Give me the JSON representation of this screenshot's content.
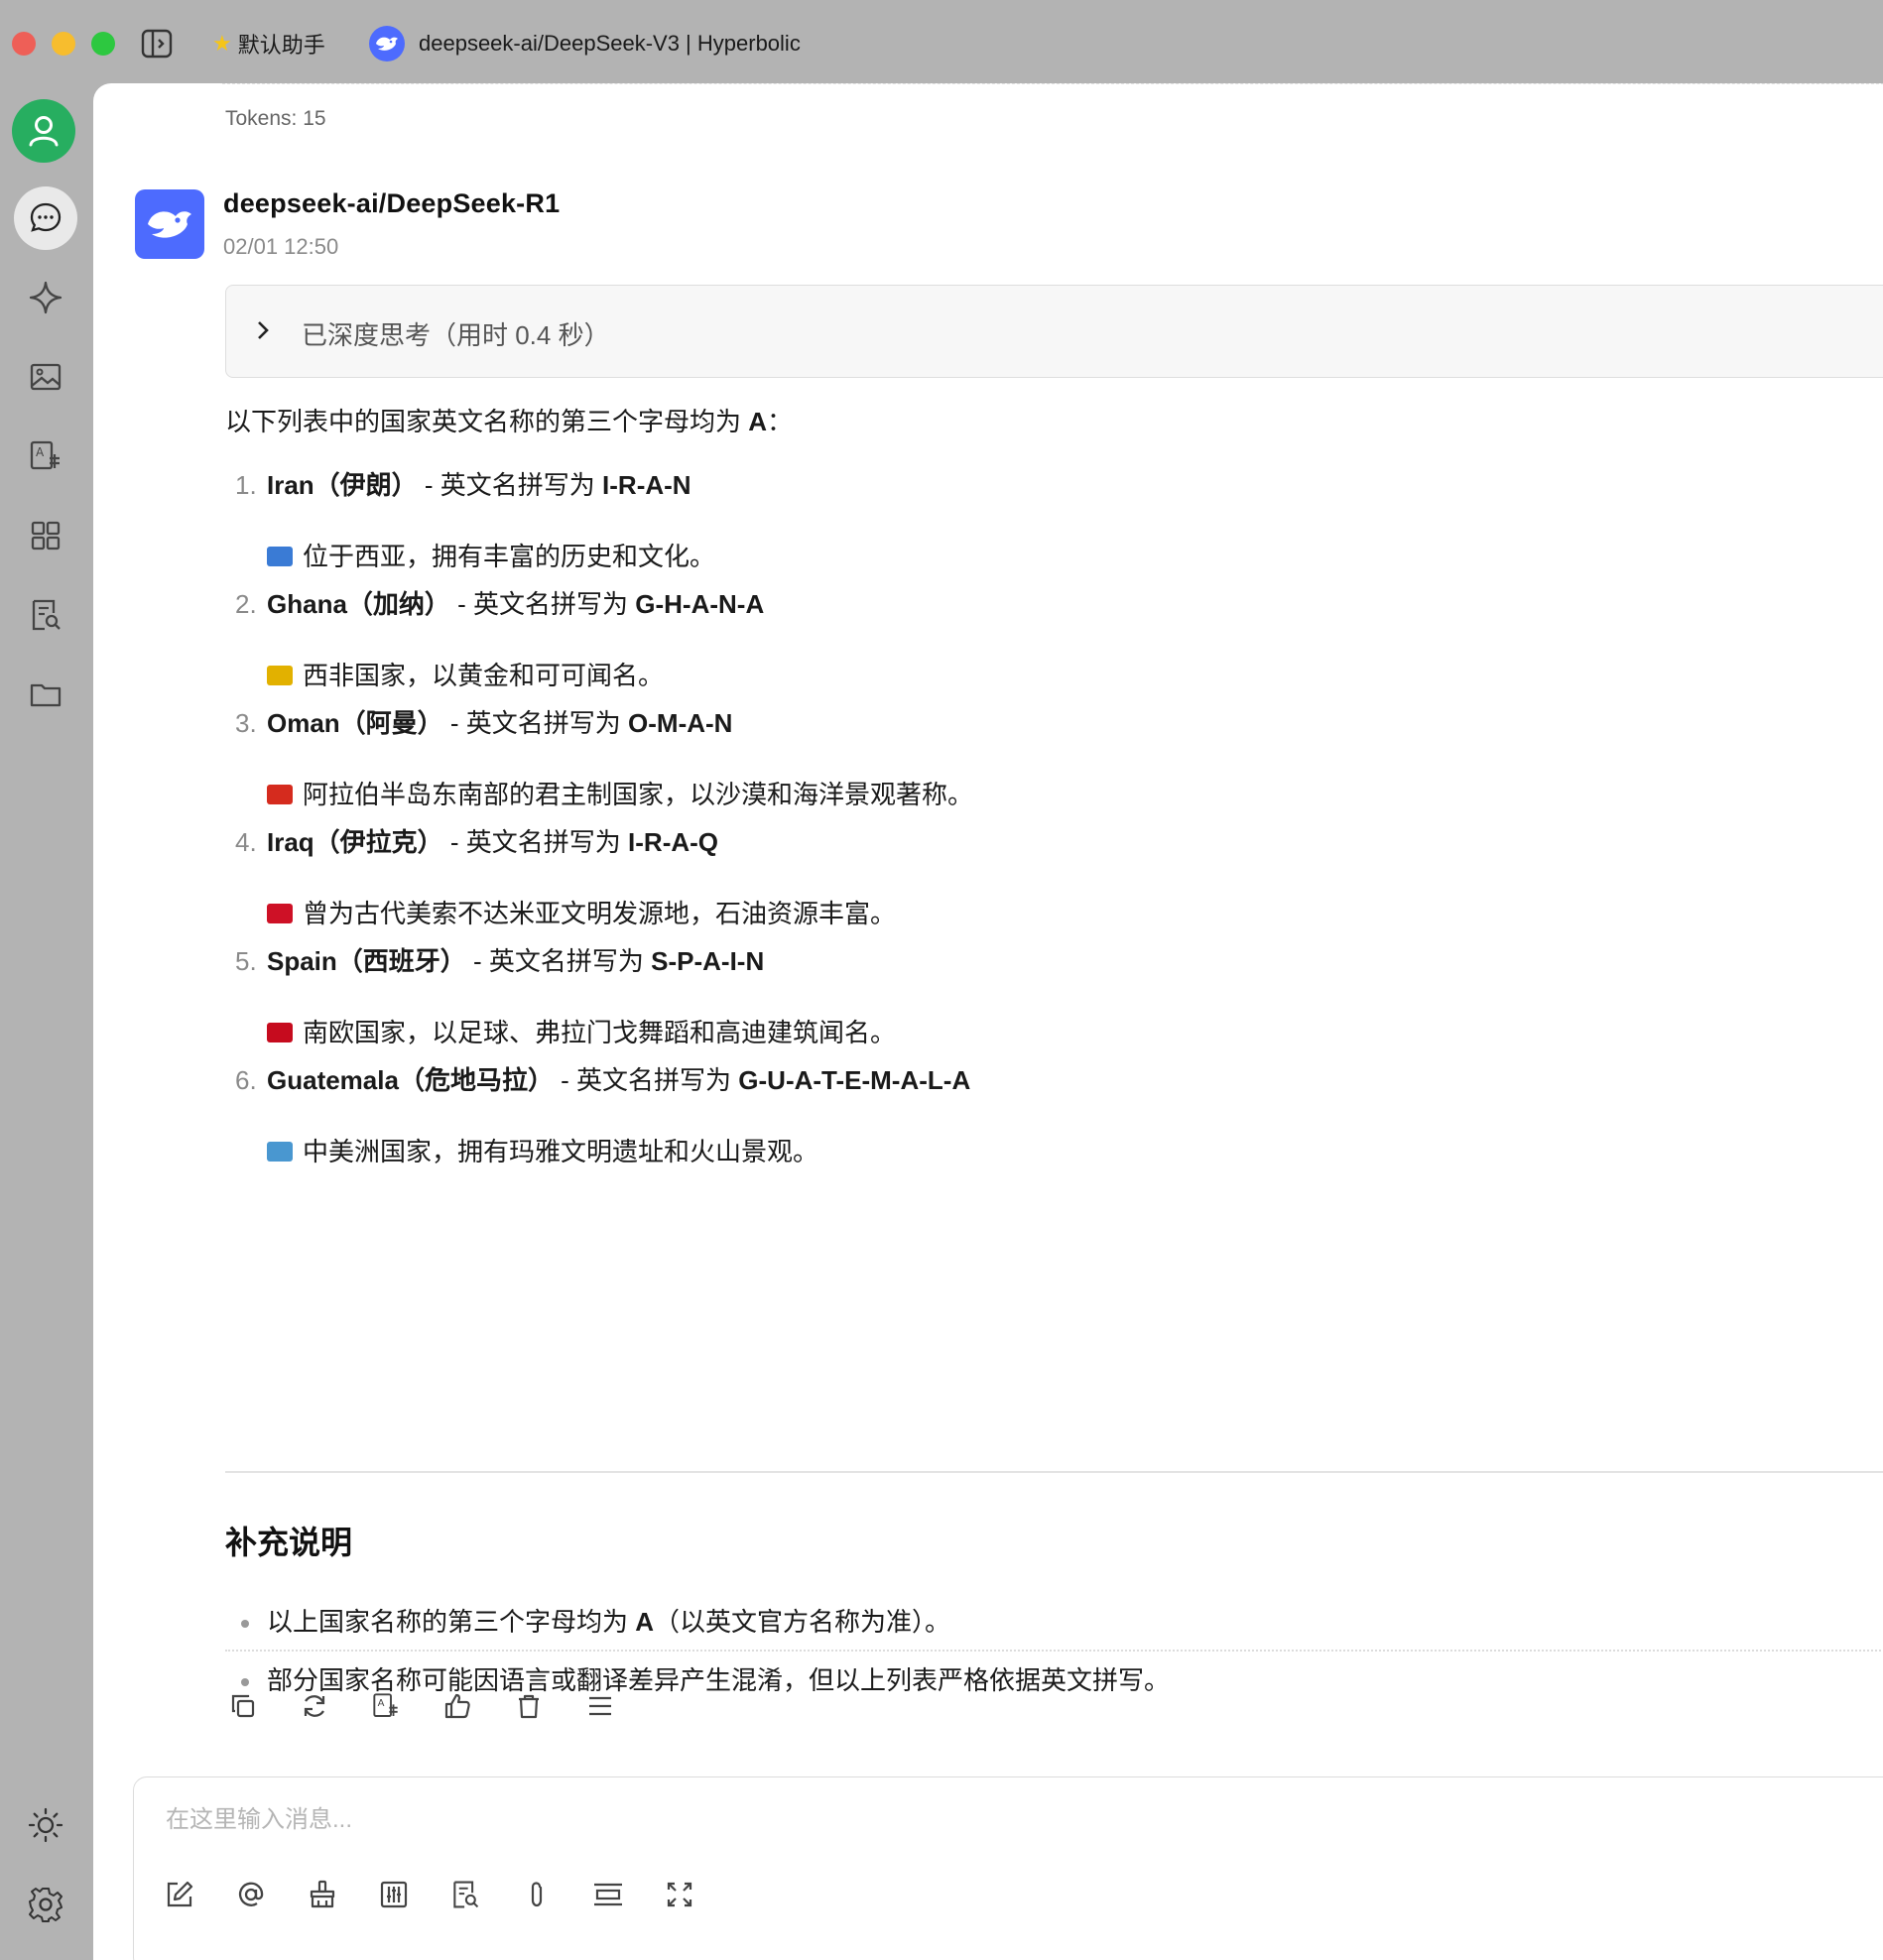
{
  "titlebar": {
    "assistant_tab": "默认助手",
    "model_tab": "deepseek-ai/DeepSeek-V3 | Hyperbolic"
  },
  "rail": {
    "items": [
      "avatar",
      "chat-icon",
      "sparkle-icon",
      "image-icon",
      "translate-icon",
      "apps-icon",
      "doc-search-icon",
      "folder-icon"
    ],
    "bottom": [
      "sun-icon",
      "gear-icon"
    ],
    "accent": "#27ae60"
  },
  "message": {
    "tokens": "Tokens: 15",
    "model_name": "deepseek-ai/DeepSeek-R1",
    "time": "02/01 12:50",
    "thinking_label": "已深度思考（用时 0.4 秒）",
    "intro_prefix": "以下列表中的国家英文名称的第三个字母均为 ",
    "intro_letter": "A",
    "intro_suffix": "：",
    "items": [
      {
        "num": "1.",
        "name": "Iran（伊朗）",
        "mid": " - 英文名拼写为 ",
        "spell": "I-R-A-N",
        "emoji_color": "#3a7bd5",
        "desc": "位于西亚，拥有丰富的历史和文化。"
      },
      {
        "num": "2.",
        "name": "Ghana（加纳）",
        "mid": " - 英文名拼写为 ",
        "spell": "G-H-A-N-A",
        "emoji_color": "#e2b100",
        "desc": "西非国家，以黄金和可可闻名。"
      },
      {
        "num": "3.",
        "name": "Oman（阿曼）",
        "mid": " - 英文名拼写为 ",
        "spell": "O-M-A-N",
        "emoji_color": "#d52b1e",
        "desc": "阿拉伯半岛东南部的君主制国家，以沙漠和海洋景观著称。"
      },
      {
        "num": "4.",
        "name": "Iraq（伊拉克）",
        "mid": " - 英文名拼写为 ",
        "spell": "I-R-A-Q",
        "emoji_color": "#ce1126",
        "desc": "曾为古代美索不达米亚文明发源地，石油资源丰富。"
      },
      {
        "num": "5.",
        "name": "Spain（西班牙）",
        "mid": " - 英文名拼写为 ",
        "spell": "S-P-A-I-N",
        "emoji_color": "#c60b1e",
        "desc": "南欧国家，以足球、弗拉门戈舞蹈和高迪建筑闻名。"
      },
      {
        "num": "6.",
        "name": "Guatemala（危地马拉）",
        "mid": " - 英文名拼写为 ",
        "spell": "G-U-A-T-E-M-A-L-A",
        "emoji_color": "#4997d0",
        "desc": "中美洲国家，拥有玛雅文明遗址和火山景观。"
      }
    ],
    "supplement_title": "补充说明",
    "bullets": [
      {
        "pre": "以上国家名称的第三个字母均为 ",
        "bold": "A",
        "post": "（以英文官方名称为准）。"
      },
      {
        "pre": "部分国家名称可能因语言或翻译差异产生混淆，但以上列表严格依据英文拼写。",
        "bold": "",
        "post": ""
      }
    ]
  },
  "actions": [
    "copy-icon",
    "regenerate-icon",
    "translate-icon",
    "thumbs-up-icon",
    "trash-icon",
    "menu-icon"
  ],
  "composer": {
    "placeholder": "在这里输入消息...",
    "tools": [
      "edit-icon",
      "at-icon",
      "broom-icon",
      "sliders-icon",
      "doc-search-icon",
      "paperclip-icon",
      "line-height-icon",
      "expand-icon"
    ]
  },
  "colors": {
    "brand": "#4d6bfe",
    "avatar": "#27ae60"
  }
}
